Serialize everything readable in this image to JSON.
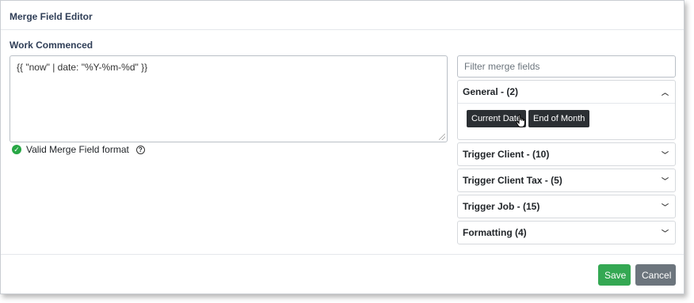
{
  "modal": {
    "title": "Merge Field Editor"
  },
  "field": {
    "label": "Work Commenced",
    "value": "{{ \"now\" | date: \"%Y-%m-%d\" }}",
    "validation_text": "Valid Merge Field format"
  },
  "filter": {
    "placeholder": "Filter merge fields"
  },
  "accordions": [
    {
      "title": "General - (2)",
      "expanded": true,
      "chips": [
        "Current Date",
        "End of Month"
      ]
    },
    {
      "title": "Trigger Client - (10)",
      "expanded": false
    },
    {
      "title": "Trigger Client Tax - (5)",
      "expanded": false
    },
    {
      "title": "Trigger Job - (15)",
      "expanded": false
    },
    {
      "title": "Formatting (4)",
      "expanded": false
    }
  ],
  "footer": {
    "save_label": "Save",
    "cancel_label": "Cancel"
  },
  "icons": {
    "check": "check-circle-icon",
    "help": "question-circle-icon",
    "chevron_up": "chevron-up-icon",
    "chevron_down": "chevron-down-icon",
    "cursor": "hand-pointer-icon"
  },
  "colors": {
    "accent": "#2f3e57",
    "success": "#28a745",
    "save": "#34a853",
    "cancel": "#6c757d",
    "chip": "#2b2f33"
  }
}
